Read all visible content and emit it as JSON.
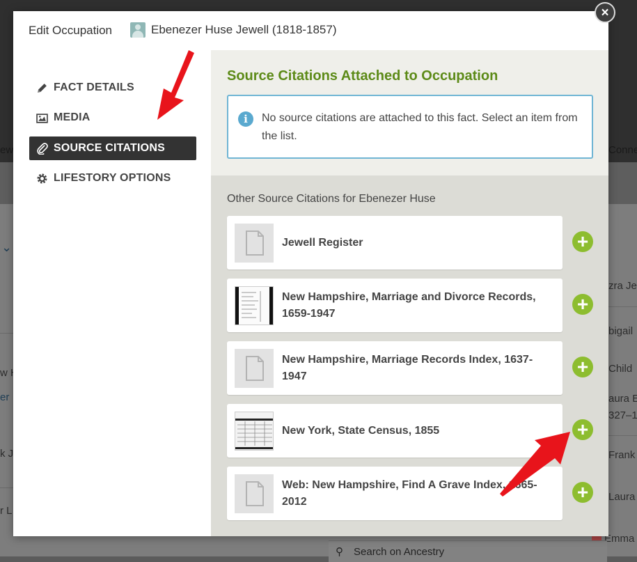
{
  "background": {
    "fragments": [
      "ew",
      "Conne",
      "zra Je",
      "bigail",
      "Child",
      "aura E",
      "327–1",
      "Frank",
      "Laura",
      "Emma",
      "w H",
      "er",
      "k J",
      "r L"
    ],
    "search_label": "Search on Ancestry"
  },
  "modal": {
    "title": "Edit Occupation",
    "person_name": "Ebenezer Huse Jewell (1818-1857)",
    "close_label": "×"
  },
  "sidebar": {
    "items": [
      {
        "label": "FACT DETAILS",
        "icon": "pencil-icon",
        "active": false
      },
      {
        "label": "MEDIA",
        "icon": "media-icon",
        "active": false
      },
      {
        "label": "SOURCE CITATIONS",
        "icon": "paperclip-icon",
        "active": true
      },
      {
        "label": "LIFESTORY OPTIONS",
        "icon": "gear-icon",
        "active": false
      }
    ]
  },
  "attached": {
    "title": "Source Citations Attached to Occupation",
    "info_text": "No source citations are attached to this fact. Select an item from the list."
  },
  "other": {
    "heading": "Other Source Citations for Ebenezer Huse",
    "items": [
      {
        "label": "Jewell Register",
        "thumb": "document-icon"
      },
      {
        "label": "New Hampshire, Marriage and Divorce Records, 1659-1947",
        "thumb": "record-image"
      },
      {
        "label": "New Hampshire, Marriage Records Index, 1637-1947",
        "thumb": "document-icon"
      },
      {
        "label": "New York, State Census, 1855",
        "thumb": "record-image"
      },
      {
        "label": "Web: New Hampshire, Find A Grave Index, 1665-2012",
        "thumb": "document-icon"
      }
    ],
    "add_label": "+"
  },
  "colors": {
    "accent_green": "#5c8a17",
    "add_green": "#8dbd2f",
    "info_blue": "#5aa9cf",
    "annotation_red": "#e8141b"
  }
}
